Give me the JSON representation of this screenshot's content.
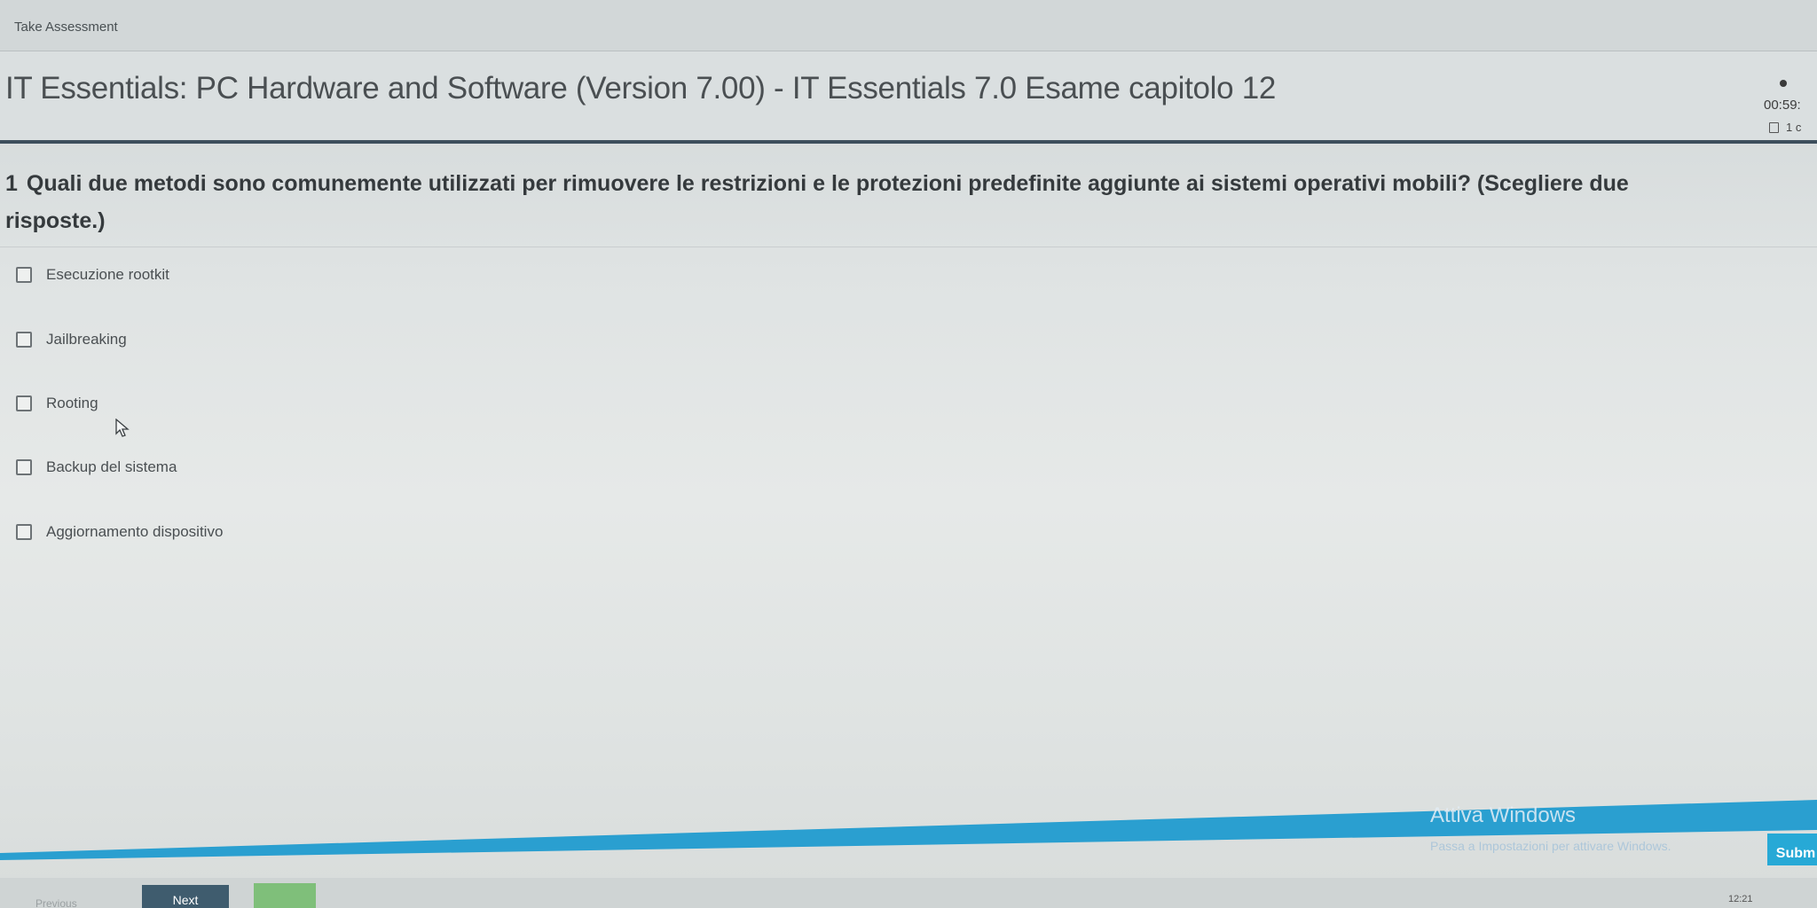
{
  "window": {
    "title": "Take Assessment"
  },
  "header": {
    "course_title": "IT Essentials: PC Hardware and Software (Version 7.00) - IT Essentials 7.0 Esame capitolo 12",
    "timer": "00:59:",
    "flag_text": "1 c"
  },
  "question": {
    "number": "1",
    "text": "Quali due metodi sono comunemente utilizzati per rimuovere le restrizioni e le protezioni predefinite aggiunte ai sistemi operativi mobili? (Scegliere due risposte.)",
    "options": [
      {
        "label": "Esecuzione rootkit",
        "checked": false
      },
      {
        "label": "Jailbreaking",
        "checked": false
      },
      {
        "label": "Rooting",
        "checked": false
      },
      {
        "label": "Backup del sistema",
        "checked": false
      },
      {
        "label": "Aggiornamento dispositivo",
        "checked": false
      }
    ]
  },
  "overlay": {
    "watermark_title": "Attiva Windows",
    "watermark_subtitle": "Passa a Impostazioni per attivare Windows."
  },
  "footer": {
    "submit_label": "Subm",
    "previous_label": "Previous",
    "next_label": "Next",
    "clock": "12:21"
  },
  "colors": {
    "header_rule": "#3e4f5d",
    "accent_blue": "#27a9d6",
    "next_button": "#3f5c6e",
    "green_button": "#7fbf7a"
  }
}
